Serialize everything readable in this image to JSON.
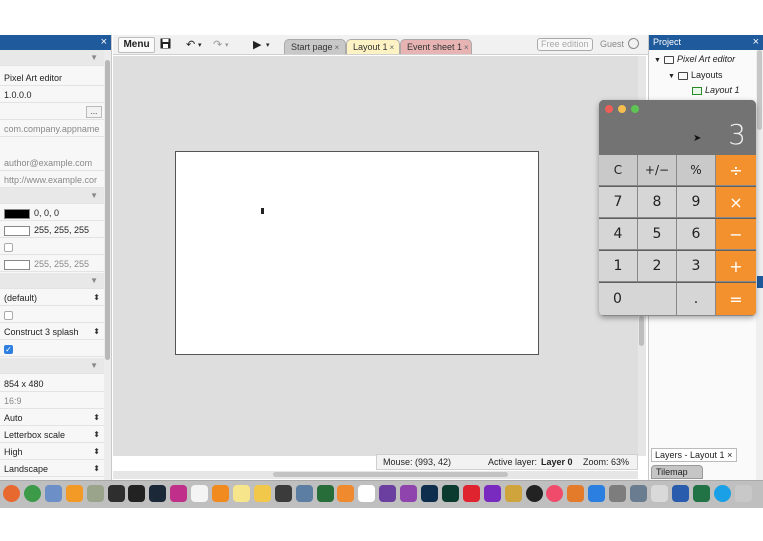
{
  "properties_panel": {
    "close_icon": "×",
    "rows": [
      {
        "text": "Pixel Art editor"
      },
      {
        "text": "1.0.0.0"
      },
      {
        "text": ""
      },
      {
        "text": "com.company.appname"
      },
      {
        "text": "author@example.com"
      },
      {
        "text": "http://www.example.cor"
      }
    ],
    "colors": [
      {
        "swatch": "#000000",
        "text": "0, 0, 0"
      },
      {
        "swatch": "#ffffff",
        "text": "255, 255, 255"
      },
      {
        "swatch": "#ffffff",
        "text": "255, 255, 255"
      }
    ],
    "selects": [
      {
        "text": "(default)"
      },
      {
        "text": "Construct 3 splash"
      }
    ],
    "window_size": "854 x 480",
    "aspect": "16:9",
    "fullscreen_selects": [
      {
        "text": "Auto"
      },
      {
        "text": "Letterbox scale"
      },
      {
        "text": "High"
      },
      {
        "text": "Landscape"
      }
    ],
    "select_arrow": "⬍",
    "ellipsis": "..."
  },
  "toolbar": {
    "menu_label": "Menu",
    "tabs": [
      {
        "label": "Start page",
        "close": "×"
      },
      {
        "label": "Layout 1",
        "close": "×"
      },
      {
        "label": "Event sheet 1",
        "close": "×"
      }
    ],
    "free_edition": "Free edition",
    "guest": "Guest"
  },
  "status": {
    "mouse": "Mouse: (993, 42)",
    "active_layer_label": "Active layer:",
    "active_layer_value": "Layer 0",
    "zoom": "Zoom: 63%"
  },
  "project_panel": {
    "title": "Project",
    "close_icon": "×",
    "root": "Pixel Art editor",
    "folder": "Layouts",
    "layout": "Layout 1",
    "layers_tab": "Layers - Layout 1",
    "layers_close": "×",
    "tilemap_tab": "Tilemap"
  },
  "calculator": {
    "display": "3",
    "rows": [
      [
        "C",
        "+/−",
        "%",
        "÷"
      ],
      [
        "7",
        "8",
        "9",
        "×"
      ],
      [
        "4",
        "5",
        "6",
        "−"
      ],
      [
        "1",
        "2",
        "3",
        "+"
      ],
      [
        "0",
        ".",
        "="
      ]
    ],
    "colors": {
      "operator": "#f2912e",
      "light_close": "#ec5f57",
      "light_min": "#f5be4f",
      "light_max": "#5fc454"
    }
  },
  "dock": {
    "icons": [
      {
        "name": "firefox-icon",
        "color": "#e8692f"
      },
      {
        "name": "chrome-icon",
        "color": "#3c9a48"
      },
      {
        "name": "lens-icon",
        "color": "#6d8fc8"
      },
      {
        "name": "sublime-icon",
        "color": "#f39a26"
      },
      {
        "name": "script-icon",
        "color": "#9aa48a"
      },
      {
        "name": "iterm-icon",
        "color": "#2e2e2e"
      },
      {
        "name": "unity-icon",
        "color": "#222222"
      },
      {
        "name": "steam-icon",
        "color": "#1b2838"
      },
      {
        "name": "spectrum-icon",
        "color": "#c0308a"
      },
      {
        "name": "calendar-icon",
        "color": "#f4f4f4"
      },
      {
        "name": "vlc-icon",
        "color": "#f28b1f"
      },
      {
        "name": "notes-icon",
        "color": "#f7e58b"
      },
      {
        "name": "photos-icon",
        "color": "#f1c84a"
      },
      {
        "name": "terminal-icon",
        "color": "#3b3b3b"
      },
      {
        "name": "quicktime-icon",
        "color": "#5d7ea3"
      },
      {
        "name": "screen-icon",
        "color": "#276d39"
      },
      {
        "name": "books-icon",
        "color": "#f08a2f"
      },
      {
        "name": "tool-icon",
        "color": "#ffffff"
      },
      {
        "name": "affinity-icon",
        "color": "#6b3fa0"
      },
      {
        "name": "affinity-photo-icon",
        "color": "#8e43ad"
      },
      {
        "name": "photoshop-icon",
        "color": "#0f2e4e"
      },
      {
        "name": "audition-icon",
        "color": "#0b3b2f"
      },
      {
        "name": "heart-icon",
        "color": "#e0242f"
      },
      {
        "name": "headphones-icon",
        "color": "#7a2bbf"
      },
      {
        "name": "logic-icon",
        "color": "#cfa43c"
      },
      {
        "name": "dot-icon",
        "color": "#222222"
      },
      {
        "name": "music-icon",
        "color": "#f04b6b"
      },
      {
        "name": "fruity-icon",
        "color": "#e37b2b"
      },
      {
        "name": "appstore-icon",
        "color": "#2a7fe0"
      },
      {
        "name": "gear-icon",
        "color": "#7d7d7d"
      },
      {
        "name": "utility-icon",
        "color": "#6a7c8f"
      },
      {
        "name": "preview-icon",
        "color": "#d9d9d9"
      },
      {
        "name": "word-icon",
        "color": "#2a5cad"
      },
      {
        "name": "excel-icon",
        "color": "#217346"
      },
      {
        "name": "skype-icon",
        "color": "#1aa0e6"
      },
      {
        "name": "trash-icon",
        "color": "#c8c8c8"
      }
    ]
  }
}
